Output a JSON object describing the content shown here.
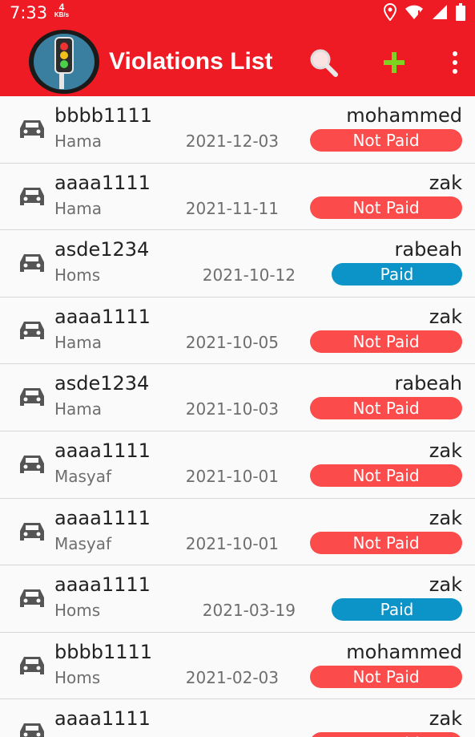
{
  "status_bar": {
    "time": "7:33",
    "net_speed_value": "4",
    "net_speed_unit": "KB/s",
    "icons": [
      "location-icon",
      "wifi-icon",
      "signal-icon",
      "battery-icon"
    ]
  },
  "app_bar": {
    "title": "Violations List",
    "actions": [
      "search-icon",
      "add-icon",
      "more-vert-icon"
    ],
    "logo": "traffic-light-icon"
  },
  "colors": {
    "primary": "#ef1b24",
    "not_paid": "#fb4b4b",
    "paid": "#0c93c7",
    "add_icon": "#7ed321"
  },
  "violations": [
    {
      "plate": "bbbb1111",
      "city": "Hama",
      "date": "2021-12-03",
      "owner": "mohammed",
      "status": "Not Paid"
    },
    {
      "plate": "aaaa1111",
      "city": "Hama",
      "date": "2021-11-11",
      "owner": "zak",
      "status": "Not Paid"
    },
    {
      "plate": "asde1234",
      "city": "Homs",
      "date": "2021-10-12",
      "owner": "rabeah",
      "status": "Paid"
    },
    {
      "plate": "aaaa1111",
      "city": "Hama",
      "date": "2021-10-05",
      "owner": "zak",
      "status": "Not Paid"
    },
    {
      "plate": "asde1234",
      "city": "Hama",
      "date": "2021-10-03",
      "owner": "rabeah",
      "status": "Not Paid"
    },
    {
      "plate": "aaaa1111",
      "city": "Masyaf",
      "date": "2021-10-01",
      "owner": "zak",
      "status": "Not Paid"
    },
    {
      "plate": "aaaa1111",
      "city": "Masyaf",
      "date": "2021-10-01",
      "owner": "zak",
      "status": "Not Paid"
    },
    {
      "plate": "aaaa1111",
      "city": "Homs",
      "date": "2021-03-19",
      "owner": "zak",
      "status": "Paid"
    },
    {
      "plate": "bbbb1111",
      "city": "Homs",
      "date": "2021-02-03",
      "owner": "mohammed",
      "status": "Not Paid"
    },
    {
      "plate": "aaaa1111",
      "city": "",
      "date": "",
      "owner": "zak",
      "status": "Not Paid"
    }
  ]
}
